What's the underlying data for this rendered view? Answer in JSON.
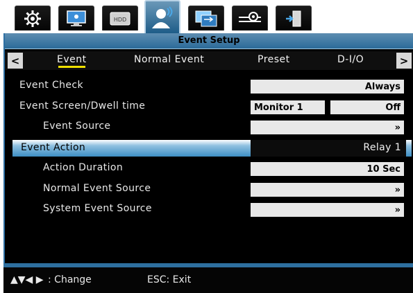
{
  "toolbar": {
    "tabs": [
      {
        "icon": "gear-icon"
      },
      {
        "icon": "display-icon"
      },
      {
        "icon": "hdd-icon",
        "label": "HDD"
      },
      {
        "icon": "user-alert-icon"
      },
      {
        "icon": "network-icon"
      },
      {
        "icon": "system-icon"
      },
      {
        "icon": "exit-icon"
      }
    ]
  },
  "window": {
    "title": "Event Setup",
    "subtabs": [
      "Event",
      "Normal Event",
      "Preset",
      "D-I/O"
    ],
    "selected_subtab": "Event",
    "prev_glyph": "<",
    "next_glyph": ">"
  },
  "rows": {
    "event_check": {
      "label": "Event Check",
      "value": "Always"
    },
    "event_screen": {
      "label": "Event Screen/Dwell time",
      "monitor": "Monitor 1",
      "dwell": "Off"
    },
    "event_source": {
      "label": "Event Source",
      "value": "»"
    },
    "event_action": {
      "label": "Event Action",
      "value": "Relay 1"
    },
    "action_duration": {
      "label": "Action Duration",
      "value": "10 Sec"
    },
    "normal_event_source": {
      "label": "Normal Event Source",
      "value": "»"
    },
    "system_event_source": {
      "label": "System Event Source",
      "value": "»"
    }
  },
  "footer": {
    "change_keys": "▲▼◀ ▶",
    "change_label": ": Change",
    "exit": "ESC: Exit"
  },
  "colors": {
    "accent": "#2b6b99",
    "highlight": "#3e8fc4",
    "selected_underline": "#f0e000"
  }
}
